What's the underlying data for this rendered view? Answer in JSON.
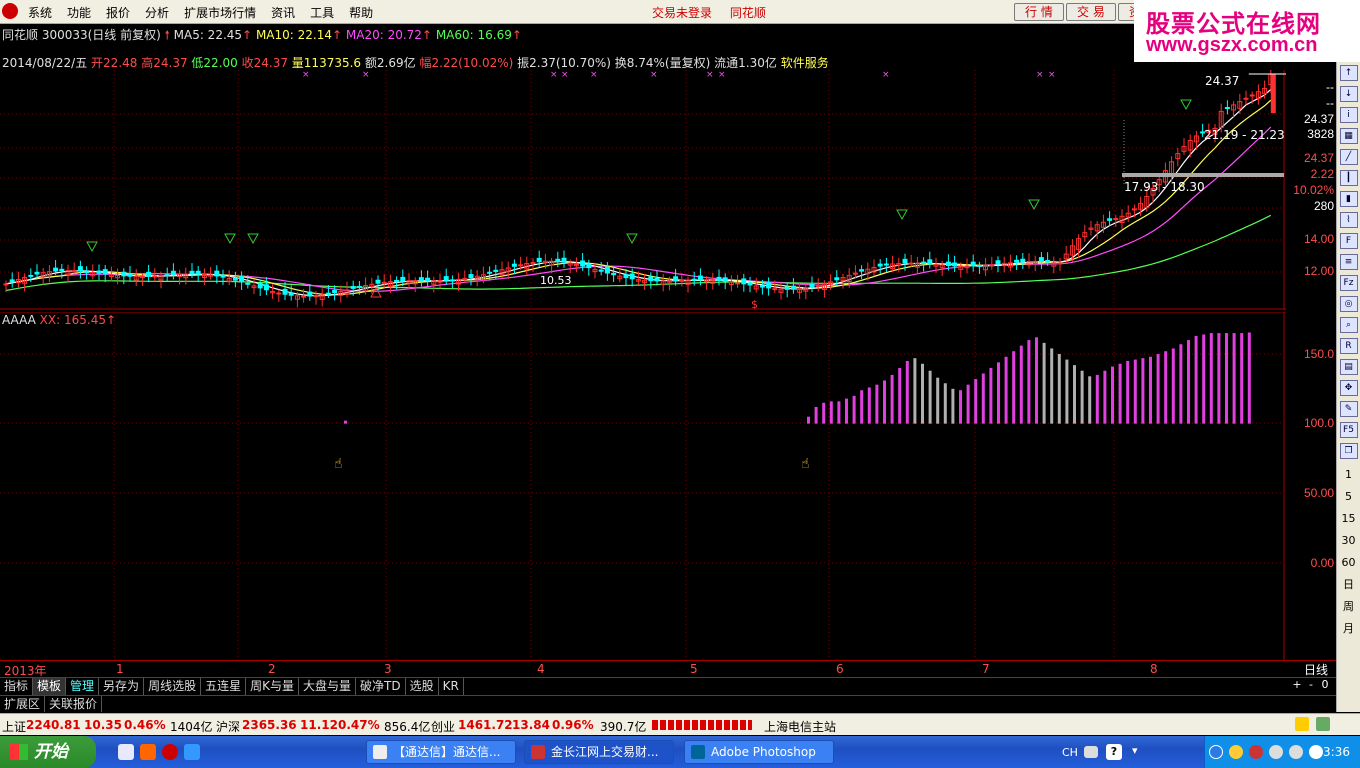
{
  "menubar": {
    "items": [
      "系统",
      "功能",
      "报价",
      "分析",
      "扩展市场行情",
      "资讯",
      "工具",
      "帮助"
    ],
    "center": [
      "交易未登录",
      "同花顺"
    ],
    "buttons": [
      "行 情",
      "交 易",
      "资"
    ]
  },
  "watermark": {
    "line1": "股票公式在线网",
    "line2": "www.gszx.com.cn"
  },
  "info1": {
    "stock": "同花顺 300033(日线 前复权)",
    "ma5": "MA5: 22.45",
    "ma10": "MA10: 22.14",
    "ma20": "MA20: 20.72",
    "ma60": "MA60: 16.69"
  },
  "info2": {
    "date": "2014/08/22/五",
    "open": "开22.48",
    "high": "高24.37",
    "low": "低22.00",
    "close": "收24.37",
    "vol": "量113735.6",
    "amount": "额2.69亿",
    "change": "幅2.22(10.02%)",
    "amplitude": "振2.37(10.70%)",
    "turnover": "换8.74%(量复权)",
    "float": "流通1.30亿",
    "service": "软件服务"
  },
  "price_axis": [
    "14.00",
    "12.00"
  ],
  "price_side": {
    "v1": "24.37",
    "d1": "--",
    "d2": "--",
    "v2": "24.37",
    "v3": "3828",
    "v4": "24.37",
    "v5": "2.22",
    "v6": "10.02%",
    "v7": "280"
  },
  "price_annotations": {
    "high_tag": "24.37",
    "range1": "21.19 - 21.23",
    "range2": "17.93 - 18.30",
    "low_tag": "10.53"
  },
  "indicator": {
    "name": "AAAA",
    "value": "XX: 165.45"
  },
  "indicator_axis": [
    "150.0",
    "100.0",
    "50.00",
    "0.00"
  ],
  "time_axis": {
    "year": "2013年",
    "months": [
      "1",
      "2",
      "3",
      "4",
      "5",
      "6",
      "7",
      "8"
    ]
  },
  "period": "日线",
  "tabs": [
    "指标",
    "模板",
    "管理",
    "另存为",
    "周线选股",
    "五连星",
    "周K与量",
    "大盘与量",
    "破净TD",
    "选股",
    "KR"
  ],
  "tab_controls": [
    "+",
    "-",
    "0"
  ],
  "ext_tabs": [
    "扩展区",
    "关联报价"
  ],
  "right_toolbar_nums": [
    "1",
    "5",
    "15",
    "30",
    "60",
    "日",
    "周",
    "月"
  ],
  "status": {
    "sh_label": "上证",
    "sh_val": "2240.81",
    "sh_chg": "10.35",
    "sh_pct": "0.46%",
    "sh_amt": "1404亿",
    "sz_label": "沪深",
    "sz_val": "2365.36",
    "sz_chg": "11.12",
    "sz_pct": "0.47%",
    "sz_amt": "856.4亿",
    "cy_label": "创业",
    "cy_val": "1461.72",
    "cy_chg": "13.84",
    "cy_pct": "0.96%",
    "cy_amt": "390.7亿",
    "station": "上海电信主站"
  },
  "taskbar": {
    "start": "开始",
    "tasks": [
      "【通达信】通达信...",
      "金长江网上交易财...",
      "Adobe Photoshop"
    ],
    "lang": "CH",
    "clock": "13:36"
  },
  "colors": {
    "up": "#ff3030",
    "down": "#00ffff",
    "ma5": "#ffffff",
    "ma10": "#ffff54",
    "ma20": "#ff4cff",
    "ma60": "#54ff54",
    "bar_magenta": "#e040e0",
    "bar_gray": "#b0b0b0"
  },
  "chart_data": {
    "type": "candlestick+indicator",
    "price_range": [
      10.5,
      24.5
    ],
    "indicator_range": [
      0,
      165.45
    ],
    "indicator_bars": [
      {
        "level": 105,
        "color": "magenta"
      },
      {
        "level": 112,
        "color": "magenta"
      },
      {
        "level": 115,
        "color": "magenta"
      },
      {
        "level": 116,
        "color": "magenta"
      },
      {
        "level": 116,
        "color": "magenta"
      },
      {
        "level": 118,
        "color": "magenta"
      },
      {
        "level": 120,
        "color": "magenta"
      },
      {
        "level": 124,
        "color": "magenta"
      },
      {
        "level": 126,
        "color": "magenta"
      },
      {
        "level": 128,
        "color": "magenta"
      },
      {
        "level": 131,
        "color": "magenta"
      },
      {
        "level": 135,
        "color": "magenta"
      },
      {
        "level": 140,
        "color": "magenta"
      },
      {
        "level": 145,
        "color": "magenta"
      },
      {
        "level": 147,
        "color": "gray"
      },
      {
        "level": 143,
        "color": "gray"
      },
      {
        "level": 138,
        "color": "gray"
      },
      {
        "level": 133,
        "color": "gray"
      },
      {
        "level": 129,
        "color": "gray"
      },
      {
        "level": 125,
        "color": "gray"
      },
      {
        "level": 124,
        "color": "magenta"
      },
      {
        "level": 128,
        "color": "magenta"
      },
      {
        "level": 132,
        "color": "magenta"
      },
      {
        "level": 136,
        "color": "magenta"
      },
      {
        "level": 140,
        "color": "magenta"
      },
      {
        "level": 144,
        "color": "magenta"
      },
      {
        "level": 148,
        "color": "magenta"
      },
      {
        "level": 152,
        "color": "magenta"
      },
      {
        "level": 156,
        "color": "magenta"
      },
      {
        "level": 160,
        "color": "magenta"
      },
      {
        "level": 162,
        "color": "magenta"
      },
      {
        "level": 158,
        "color": "gray"
      },
      {
        "level": 154,
        "color": "gray"
      },
      {
        "level": 150,
        "color": "gray"
      },
      {
        "level": 146,
        "color": "gray"
      },
      {
        "level": 142,
        "color": "gray"
      },
      {
        "level": 138,
        "color": "gray"
      },
      {
        "level": 134,
        "color": "gray"
      },
      {
        "level": 135,
        "color": "magenta"
      },
      {
        "level": 138,
        "color": "magenta"
      },
      {
        "level": 141,
        "color": "magenta"
      },
      {
        "level": 143,
        "color": "magenta"
      },
      {
        "level": 145,
        "color": "magenta"
      },
      {
        "level": 146,
        "color": "magenta"
      },
      {
        "level": 147,
        "color": "magenta"
      },
      {
        "level": 148,
        "color": "magenta"
      },
      {
        "level": 150,
        "color": "magenta"
      },
      {
        "level": 152,
        "color": "magenta"
      },
      {
        "level": 154,
        "color": "magenta"
      },
      {
        "level": 157,
        "color": "magenta"
      },
      {
        "level": 160,
        "color": "magenta"
      },
      {
        "level": 163,
        "color": "magenta"
      },
      {
        "level": 164,
        "color": "magenta"
      },
      {
        "level": 165,
        "color": "magenta"
      },
      {
        "level": 165,
        "color": "magenta"
      },
      {
        "level": 165,
        "color": "magenta"
      },
      {
        "level": 165,
        "color": "magenta"
      },
      {
        "level": 165,
        "color": "magenta"
      },
      {
        "level": 165.45,
        "color": "magenta"
      }
    ]
  }
}
